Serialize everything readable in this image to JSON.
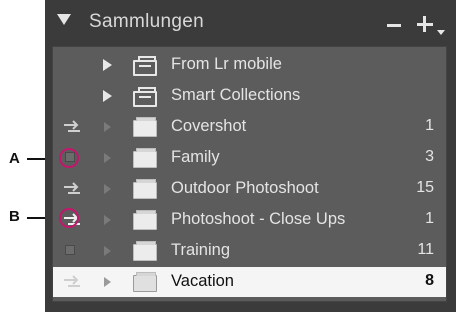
{
  "panel": {
    "title": "Sammlungen",
    "minus_icon": "minus-icon",
    "plus_icon": "plus-dropdown-icon"
  },
  "callouts": [
    {
      "label": "A"
    },
    {
      "label": "B"
    }
  ],
  "rows": [
    {
      "kind": "set",
      "name": "From Lr mobile",
      "count": ""
    },
    {
      "kind": "set",
      "name": "Smart Collections",
      "count": ""
    },
    {
      "kind": "collection",
      "name": "Covershot",
      "count": "1",
      "sync": "arrows"
    },
    {
      "kind": "collection",
      "name": "Family",
      "count": "3",
      "sync": "box"
    },
    {
      "kind": "collection",
      "name": "Outdoor Photoshoot",
      "count": "15",
      "sync": "arrows"
    },
    {
      "kind": "collection",
      "name": "Photoshoot - Close Ups",
      "count": "1",
      "sync": "arrows"
    },
    {
      "kind": "collection",
      "name": "Training",
      "count": "11",
      "sync": "box"
    },
    {
      "kind": "collection",
      "name": "Vacation",
      "count": "8",
      "sync": "arrows",
      "selected": true
    }
  ],
  "colors": {
    "panel_bg": "#3b3b3b",
    "list_bg": "#5c5c5c",
    "selected_bg": "#f5f5f5",
    "callout_ring": "#c2186b"
  }
}
